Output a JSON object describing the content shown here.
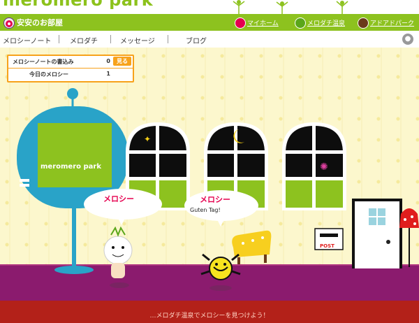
{
  "header": {
    "brand": "meromero park",
    "room_title": "安安のお部屋",
    "links": [
      "マイホーム",
      "メロダチ温泉",
      "アドアドパーク"
    ]
  },
  "nav": {
    "items": [
      "メロシーノート",
      "メロダチ",
      "メッセージ",
      "ブログ"
    ]
  },
  "stats": {
    "rows": [
      {
        "label": "メロシーノートの書込み",
        "value": "0"
      },
      {
        "label": "今日のメロシー",
        "value": "1"
      }
    ],
    "view_button": "見る"
  },
  "scene": {
    "sign_logo": "meromero park",
    "bubble1_name": "メロシー",
    "bubble2_name": "メロシー",
    "bubble2_text": "Guten Tag!",
    "post_label": "POST",
    "bottom_marquee": "…メロダチ温泉でメロシーを見つけよう！"
  },
  "colors": {
    "header_green": "#8dc21f",
    "floor": "#8b1b6e",
    "band": "#b32119",
    "accent_orange": "#f7a21b"
  }
}
